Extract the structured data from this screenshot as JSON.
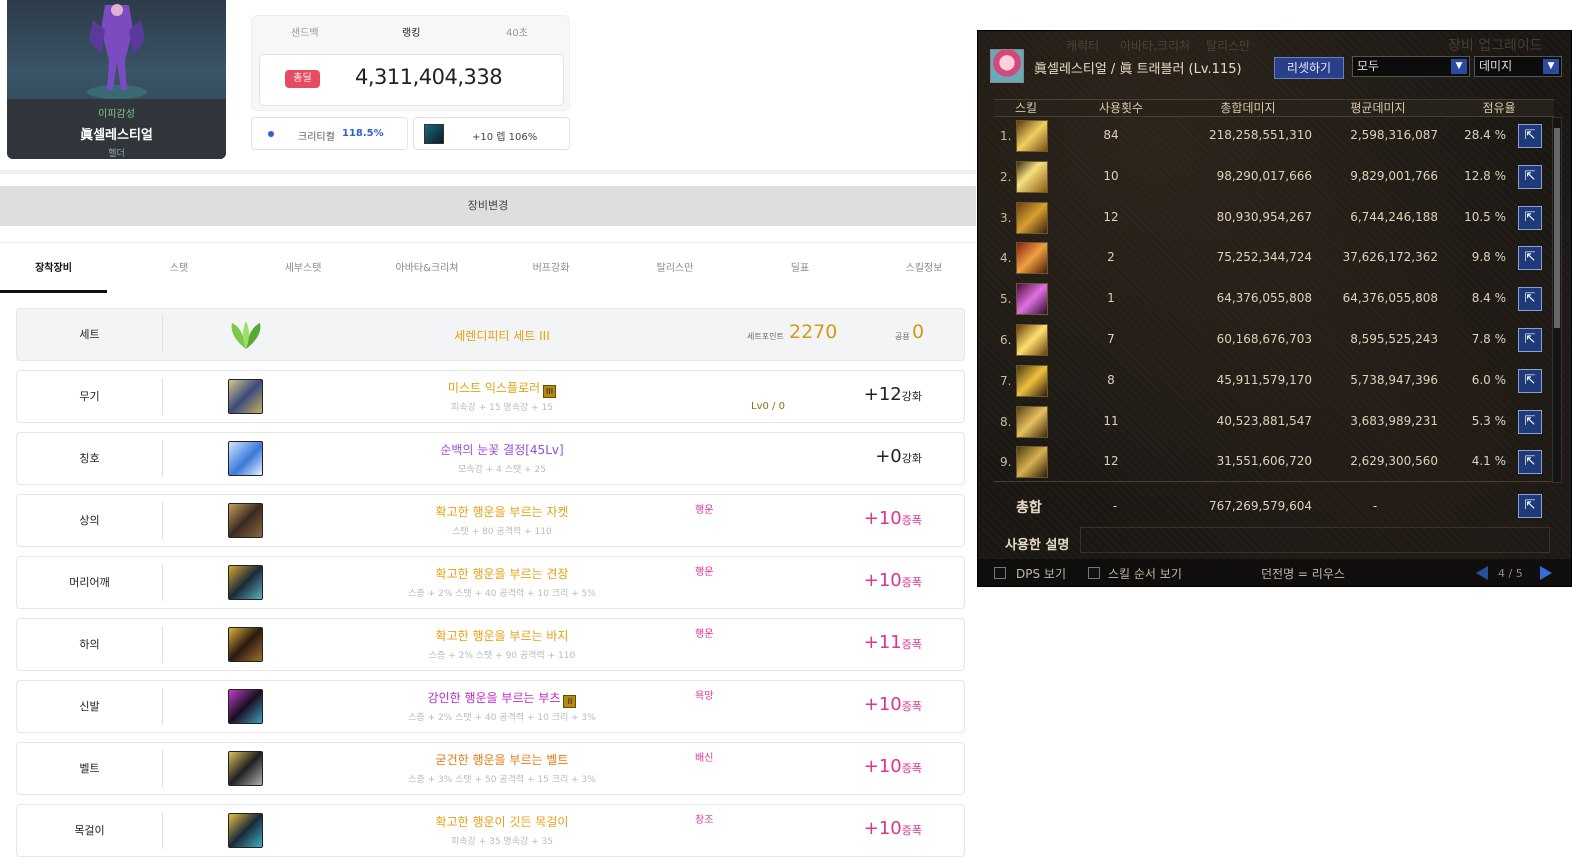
{
  "character": {
    "guild": "이피감성",
    "name": "眞셀레스티얼",
    "job": "헬더"
  },
  "ranking": {
    "tabs": [
      "샌드백",
      "랭킹",
      "40초"
    ],
    "badge": "총딜",
    "value": "4,311,404,338"
  },
  "stats": {
    "crit_label": "크리티컬",
    "crit_value": "118.5%",
    "level_text": "+10 렙 106%"
  },
  "equip_change": "장비변경",
  "tabs": [
    "장착장비",
    "스탯",
    "세부스탯",
    "아바타&크리쳐",
    "버프강화",
    "탈리스만",
    "딜표",
    "스킬정보"
  ],
  "set_row": {
    "slot": "세트",
    "name": "세렌디피티 세트 III",
    "point_label": "세트포인트",
    "point_value": "2270",
    "common_label": "공용",
    "common_value": "0",
    "name_color": "#e8a010"
  },
  "equipment": [
    {
      "slot": "무기",
      "name": "미스트 익스플로러",
      "grade": "III",
      "sub": "피속강 + 15 명속강 + 15",
      "tag": "",
      "level": "Lv0 / 0",
      "plus": "+12",
      "kind": "강화",
      "name_color": "#e8a010",
      "plus_color": "#222222",
      "icon": "weapon-icon"
    },
    {
      "slot": "칭호",
      "name": "순백의 눈꽃 결정[45Lv]",
      "grade": "",
      "sub": "모속강 + 4 스탯 + 25",
      "tag": "",
      "level": "",
      "plus": "+0",
      "kind": "강화",
      "name_color": "#9b4ad6",
      "plus_color": "#222222",
      "icon": "title-icon"
    },
    {
      "slot": "상의",
      "name": "확고한 행운을 부르는 자켓",
      "grade": "",
      "sub": "스탯 + 80 공격력 + 110",
      "tag": "행운",
      "level": "",
      "plus": "+10",
      "kind": "증폭",
      "name_color": "#e8a010",
      "plus_color": "#e0338e",
      "icon": "jacket-icon"
    },
    {
      "slot": "머리어깨",
      "name": "확고한 행운을 부르는 견장",
      "grade": "",
      "sub": "스증 + 2% 스탯 + 40 공격력 + 10 크리 + 5%",
      "tag": "행운",
      "level": "",
      "plus": "+10",
      "kind": "증폭",
      "name_color": "#e8a010",
      "plus_color": "#e0338e",
      "icon": "shoulder-icon"
    },
    {
      "slot": "하의",
      "name": "확고한 행운을 부르는 바지",
      "grade": "",
      "sub": "스증 + 2% 스탯 + 90 공격력 + 110",
      "tag": "행운",
      "level": "",
      "plus": "+11",
      "kind": "증폭",
      "name_color": "#e8a010",
      "plus_color": "#e0338e",
      "icon": "pants-icon"
    },
    {
      "slot": "신발",
      "name": "강인한 행운을 부르는 부츠",
      "grade": "II",
      "sub": "스증 + 2% 스탯 + 40 공격력 + 10 크리 + 3%",
      "tag": "욕망",
      "level": "",
      "plus": "+10",
      "kind": "증폭",
      "name_color": "#c026c8",
      "plus_color": "#e0338e",
      "icon": "boots-icon"
    },
    {
      "slot": "벨트",
      "name": "굳건한 행운을 부르는 벨트",
      "grade": "",
      "sub": "스증 + 3% 스탯 + 50 공격력 + 15 크리 + 3%",
      "tag": "배신",
      "level": "",
      "plus": "+10",
      "kind": "증폭",
      "name_color": "#e87a10",
      "plus_color": "#e0338e",
      "icon": "belt-icon"
    },
    {
      "slot": "목걸이",
      "name": "확고한 행운이 깃든 목걸이",
      "grade": "",
      "sub": "피속강 + 35 명속강 + 35",
      "tag": "창조",
      "level": "",
      "plus": "+10",
      "kind": "증폭",
      "name_color": "#e8a010",
      "plus_color": "#e0338e",
      "icon": "necklace-icon"
    }
  ],
  "game": {
    "title": "眞셀레스티얼 / 眞 트래블러 (Lv.115)",
    "reset": "리셋하기",
    "filter": "모두",
    "sort": "데미지",
    "bg_text": [
      "캐릭터",
      "아바타,크리처",
      "탈리스만",
      "장비 업그레이드"
    ],
    "headers": [
      "스킬",
      "사용횟수",
      "총합데미지",
      "평균데미지",
      "점유율"
    ],
    "rows": [
      {
        "no": "1.",
        "count": "84",
        "total": "218,258,551,310",
        "avg": "2,598,316,087",
        "share": "28.4 %"
      },
      {
        "no": "2.",
        "count": "10",
        "total": "98,290,017,666",
        "avg": "9,829,001,766",
        "share": "12.8 %"
      },
      {
        "no": "3.",
        "count": "12",
        "total": "80,930,954,267",
        "avg": "6,744,246,188",
        "share": "10.5 %"
      },
      {
        "no": "4.",
        "count": "2",
        "total": "75,252,344,724",
        "avg": "37,626,172,362",
        "share": "9.8 %"
      },
      {
        "no": "5.",
        "count": "1",
        "total": "64,376,055,808",
        "avg": "64,376,055,808",
        "share": "8.4 %"
      },
      {
        "no": "6.",
        "count": "7",
        "total": "60,168,676,703",
        "avg": "8,595,525,243",
        "share": "7.8 %"
      },
      {
        "no": "7.",
        "count": "8",
        "total": "45,911,579,170",
        "avg": "5,738,947,396",
        "share": "6.0 %"
      },
      {
        "no": "8.",
        "count": "11",
        "total": "40,523,881,547",
        "avg": "3,683,989,231",
        "share": "5.3 %"
      },
      {
        "no": "9.",
        "count": "12",
        "total": "31,551,606,720",
        "avg": "2,629,300,560",
        "share": "4.1 %"
      }
    ],
    "total_label": "총합",
    "total_count": "-",
    "total_damage": "767,269,579,604",
    "total_avg": "-",
    "desc_label": "사용한 설명",
    "dps_label": "DPS 보기",
    "order_label": "스킬 순서 보기",
    "dungeon": "던전명 = 리우스",
    "page": "4 / 5"
  }
}
